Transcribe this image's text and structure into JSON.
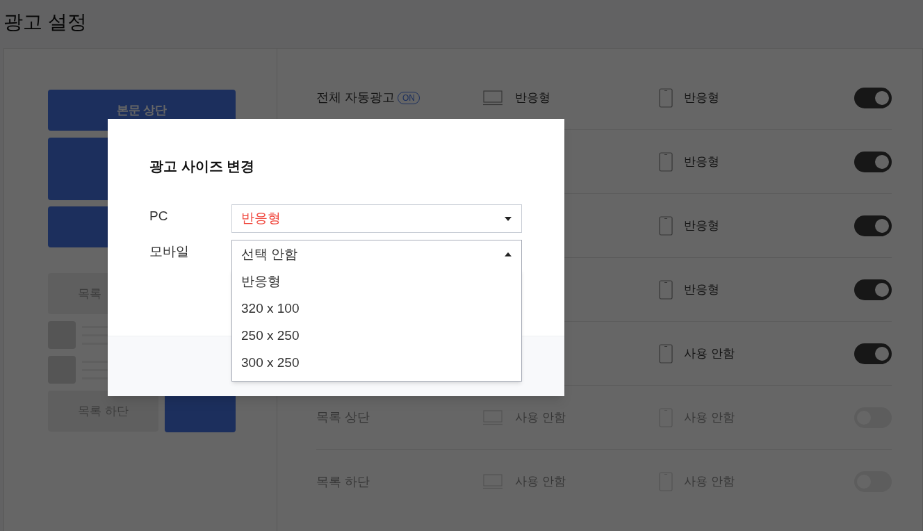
{
  "page": {
    "title": "광고 설정"
  },
  "preview": {
    "top_label": "본문 상단",
    "list_top_label": "목록",
    "list_bottom_label": "목록 하단"
  },
  "rows": [
    {
      "label": "전체 자동광고",
      "badge": "ON",
      "pc": "반응형",
      "mobile": "반응형",
      "on": true
    },
    {
      "mobile": "반응형",
      "on": true
    },
    {
      "mobile": "반응형",
      "on": true
    },
    {
      "mobile": "반응형",
      "on": true
    },
    {
      "mobile": "사용 안함",
      "on": true
    },
    {
      "label": "목록 상단",
      "pc": "사용 안함",
      "mobile": "사용 안함",
      "on": false
    },
    {
      "label": "목록 하단",
      "pc": "사용 안함",
      "mobile": "사용 안함",
      "on": false
    }
  ],
  "modal": {
    "title": "광고 사이즈 변경",
    "fields": [
      {
        "label": "PC",
        "value": "반응형",
        "changed": true,
        "expanded": false
      },
      {
        "label": "모바일",
        "value": "선택 안함",
        "changed": false,
        "expanded": true,
        "options": [
          "반응형",
          "320 x 100",
          "250 x 250",
          "300 x 250"
        ]
      }
    ]
  }
}
